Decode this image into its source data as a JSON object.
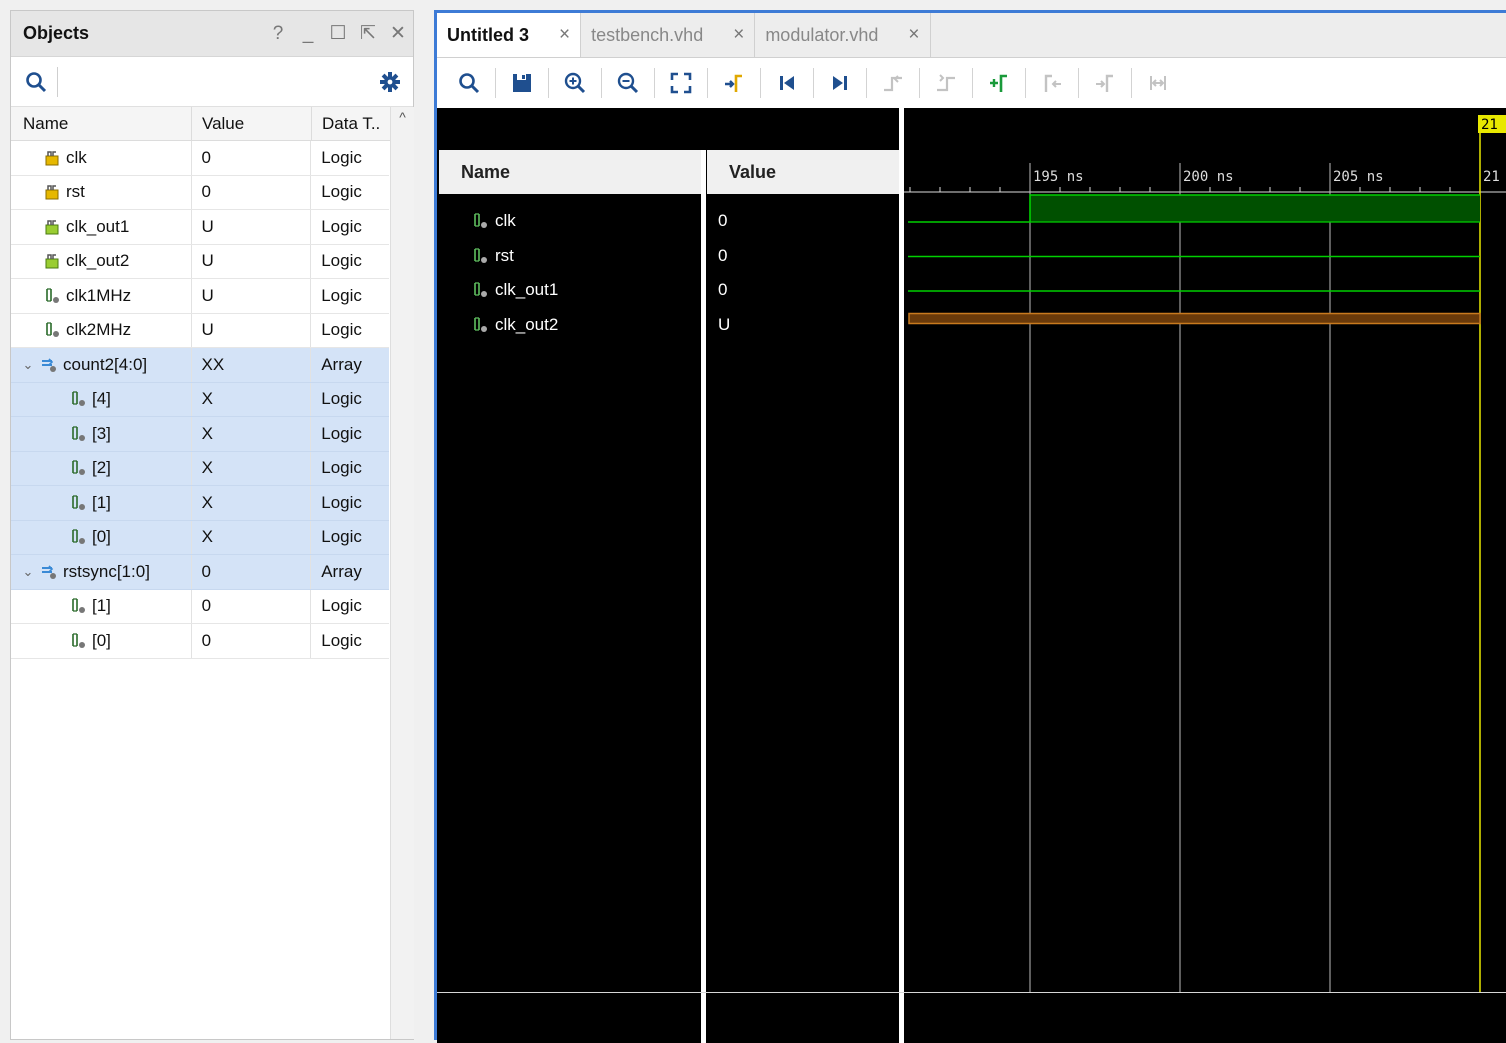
{
  "objects_panel": {
    "title": "Objects",
    "controls": [
      "?",
      "_",
      "☐",
      "⇱",
      "✕"
    ],
    "columns": {
      "name": "Name",
      "value": "Value",
      "type": "Data T.."
    },
    "rows": [
      {
        "name": "clk",
        "value": "0",
        "type": "Logic",
        "icon": "input-port-icon",
        "indent": 0,
        "sel": false
      },
      {
        "name": "rst",
        "value": "0",
        "type": "Logic",
        "icon": "input-port-icon",
        "indent": 0,
        "sel": false
      },
      {
        "name": "clk_out1",
        "value": "U",
        "type": "Logic",
        "icon": "output-port-icon",
        "indent": 0,
        "sel": false
      },
      {
        "name": "clk_out2",
        "value": "U",
        "type": "Logic",
        "icon": "output-port-icon",
        "indent": 0,
        "sel": false
      },
      {
        "name": "clk1MHz",
        "value": "U",
        "type": "Logic",
        "icon": "signal-icon",
        "indent": 0,
        "sel": false
      },
      {
        "name": "clk2MHz",
        "value": "U",
        "type": "Logic",
        "icon": "signal-icon",
        "indent": 0,
        "sel": false
      },
      {
        "name": "count2[4:0]",
        "value": "XX",
        "type": "Array",
        "icon": "bus-icon",
        "indent": 0,
        "sel": true,
        "expanded": true
      },
      {
        "name": "[4]",
        "value": "X",
        "type": "Logic",
        "icon": "signal-icon",
        "indent": 1,
        "sel": true
      },
      {
        "name": "[3]",
        "value": "X",
        "type": "Logic",
        "icon": "signal-icon",
        "indent": 1,
        "sel": true
      },
      {
        "name": "[2]",
        "value": "X",
        "type": "Logic",
        "icon": "signal-icon",
        "indent": 1,
        "sel": true
      },
      {
        "name": "[1]",
        "value": "X",
        "type": "Logic",
        "icon": "signal-icon",
        "indent": 1,
        "sel": true
      },
      {
        "name": "[0]",
        "value": "X",
        "type": "Logic",
        "icon": "signal-icon",
        "indent": 1,
        "sel": true
      },
      {
        "name": "rstsync[1:0]",
        "value": "0",
        "type": "Array",
        "icon": "bus-icon",
        "indent": 0,
        "sel": true,
        "expanded": true
      },
      {
        "name": "[1]",
        "value": "0",
        "type": "Logic",
        "icon": "signal-icon",
        "indent": 1,
        "sel": false
      },
      {
        "name": "[0]",
        "value": "0",
        "type": "Logic",
        "icon": "signal-icon",
        "indent": 1,
        "sel": false
      }
    ]
  },
  "wave_panel": {
    "tabs": [
      {
        "label": "Untitled 3",
        "active": true
      },
      {
        "label": "testbench.vhd",
        "active": false
      },
      {
        "label": "modulator.vhd",
        "active": false
      }
    ],
    "toolbar_icons": [
      "search-icon",
      "save-icon",
      "zoom-in-icon",
      "zoom-out-icon",
      "zoom-fit-icon",
      "go-to-cursor-icon",
      "go-to-start-icon",
      "go-to-end-icon",
      "previous-transition-icon",
      "next-transition-icon",
      "add-marker-icon",
      "previous-marker-icon",
      "next-marker-icon",
      "swap-cursors-icon"
    ],
    "name_header": "Name",
    "value_header": "Value",
    "signals": [
      {
        "name": "clk",
        "value": "0"
      },
      {
        "name": "rst",
        "value": "0"
      },
      {
        "name": "clk_out1",
        "value": "0"
      },
      {
        "name": "clk_out2",
        "value": "U"
      }
    ],
    "timeline": {
      "ticks": [
        "195 ns",
        "200 ns",
        "205 ns",
        "21"
      ],
      "cursor_label": "21"
    },
    "colors": {
      "signal_green": "#00d000",
      "high_fill": "#005000",
      "undefined_orange": "#c87a1e",
      "cursor_yellow": "#e8e800"
    }
  }
}
